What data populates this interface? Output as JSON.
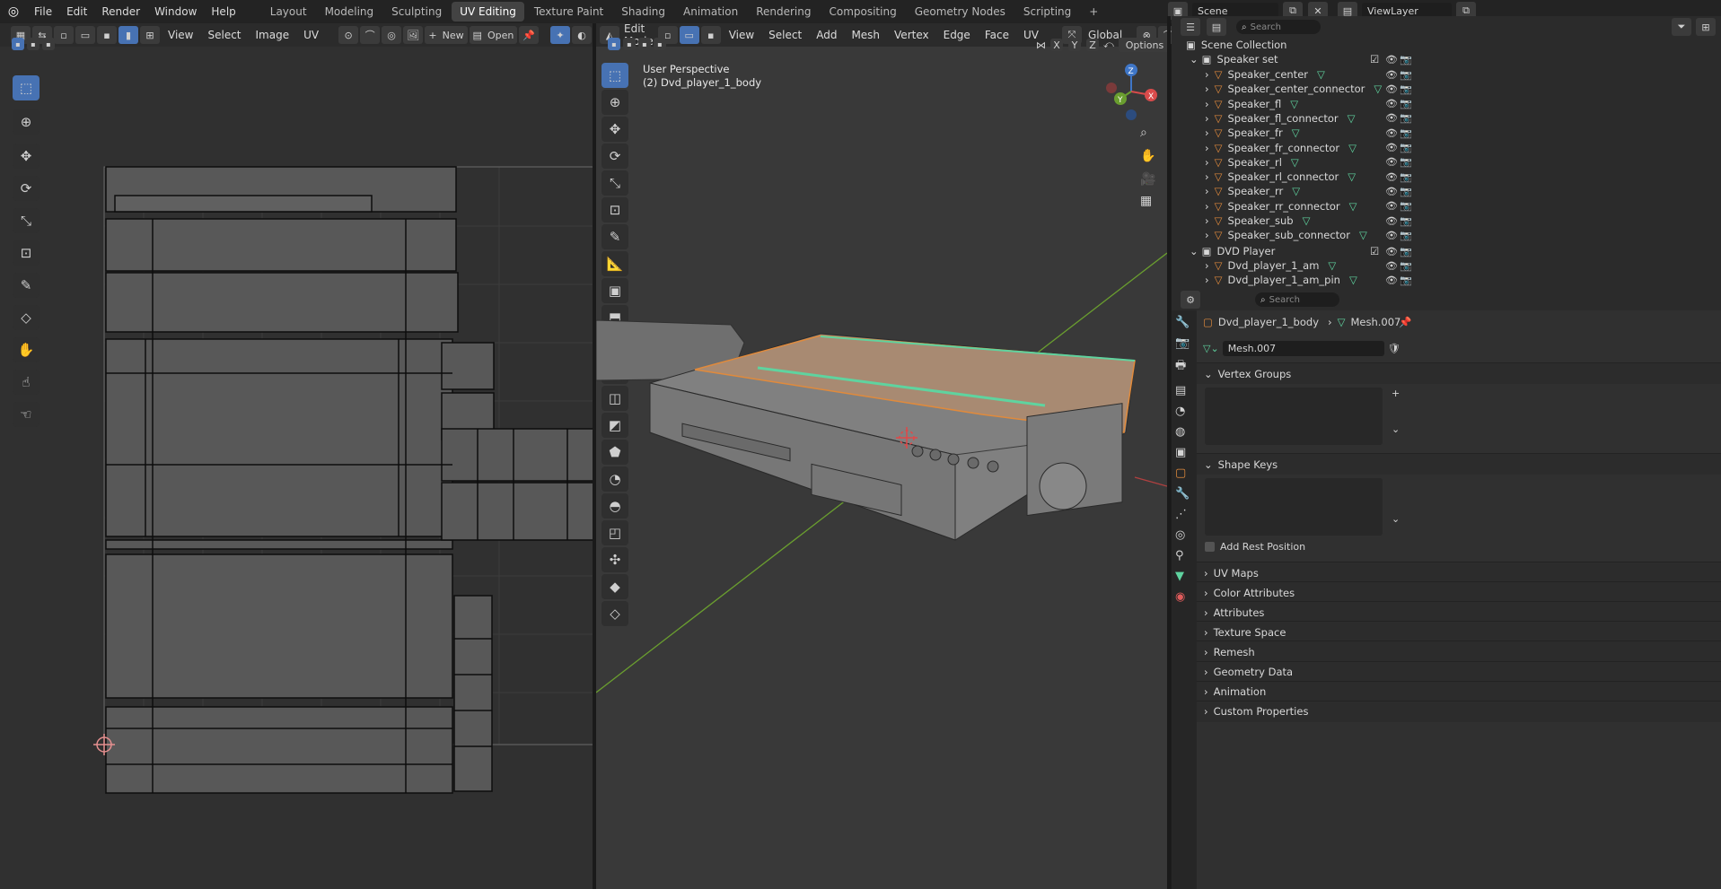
{
  "menu": [
    "File",
    "Edit",
    "Render",
    "Window",
    "Help"
  ],
  "workspaces": [
    "Layout",
    "Modeling",
    "Sculpting",
    "UV Editing",
    "Texture Paint",
    "Shading",
    "Animation",
    "Rendering",
    "Compositing",
    "Geometry Nodes",
    "Scripting"
  ],
  "active_workspace": "UV Editing",
  "scene": {
    "label": "Scene",
    "view_layer": "ViewLayer"
  },
  "uv_editor": {
    "menus": [
      "View",
      "Select",
      "Image",
      "UV"
    ],
    "new_label": "New",
    "open_label": "Open"
  },
  "viewport": {
    "mode": "Edit Mode",
    "menus": [
      "View",
      "Select",
      "Add",
      "Mesh",
      "Vertex",
      "Edge",
      "Face",
      "UV"
    ],
    "transform_orientation": "Global",
    "axes": [
      "X",
      "Y",
      "Z"
    ],
    "options_label": "Options",
    "overlay_line1": "User Perspective",
    "overlay_line2": "(2) Dvd_player_1_body",
    "gizmo": {
      "x": "X",
      "y": "Y",
      "z": "Z"
    }
  },
  "outliner": {
    "search_placeholder": "Search",
    "root": "Scene Collection",
    "collections": [
      {
        "name": "Speaker set",
        "items": [
          "Speaker_center",
          "Speaker_center_connector",
          "Speaker_fl",
          "Speaker_fl_connector",
          "Speaker_fr",
          "Speaker_fr_connector",
          "Speaker_rl",
          "Speaker_rl_connector",
          "Speaker_rr",
          "Speaker_rr_connector",
          "Speaker_sub",
          "Speaker_sub_connector"
        ]
      },
      {
        "name": "DVD Player",
        "items": [
          "Dvd_player_1_am",
          "Dvd_player_1_am_pin"
        ]
      }
    ]
  },
  "properties": {
    "search_placeholder": "Search",
    "breadcrumb_object": "Dvd_player_1_body",
    "breadcrumb_mesh": "Mesh.007",
    "mesh_name": "Mesh.007",
    "panels": [
      "Vertex Groups",
      "Shape Keys"
    ],
    "add_rest_position": "Add Rest Position",
    "collapsed_panels": [
      "UV Maps",
      "Color Attributes",
      "Attributes",
      "Texture Space",
      "Remesh",
      "Geometry Data",
      "Animation",
      "Custom Properties"
    ]
  },
  "colors": {
    "accent": "#4772b3",
    "orange": "#e08a3c",
    "green": "#5fd39f",
    "x_axis": "#d94b4b",
    "y_axis": "#6a9e2f",
    "z_axis": "#3f76c7"
  }
}
